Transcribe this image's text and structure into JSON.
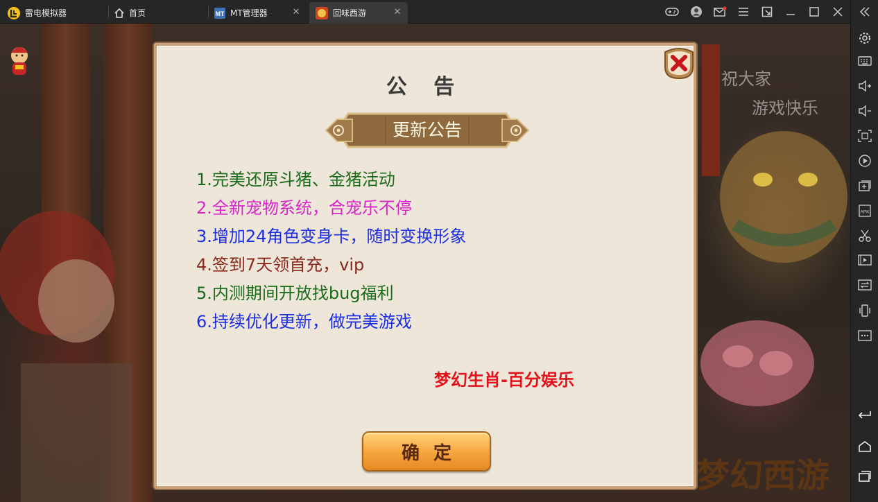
{
  "tabs": [
    {
      "label": "雷电模拟器",
      "icon": "ldplayer-logo-icon"
    },
    {
      "label": "首页",
      "icon": "home-icon"
    },
    {
      "label": "MT管理器",
      "icon": "mt-manager-icon"
    },
    {
      "label": "回味西游",
      "icon": "game-icon"
    }
  ],
  "window_controls": [
    "gamepad-icon",
    "user-icon",
    "mail-icon",
    "menu-icon",
    "popout-icon",
    "minimize-icon",
    "maximize-icon",
    "close-icon",
    "collapse-icon"
  ],
  "sidebar_icons": [
    "settings-icon",
    "keyboard-icon",
    "volume-up-icon",
    "volume-down-icon",
    "screenshot-icon",
    "record-icon",
    "add-window-icon",
    "apk-icon",
    "cut-icon",
    "video-icon",
    "sync-icon",
    "shake-icon",
    "more-icon",
    "back-icon",
    "home-icon",
    "recent-apps-icon"
  ],
  "dialog": {
    "title": "公 告",
    "banner": "更新公告",
    "notes": [
      {
        "text": "1.完美还原斗猪、金猪活动",
        "color": "#1a6b1a"
      },
      {
        "text": "2.全新宠物系统，合宠乐不停",
        "color": "#d626c8"
      },
      {
        "text": "3.增加24角色变身卡，随时变换形象",
        "color": "#1c2fe0"
      },
      {
        "text": "4.签到7天领首充，vip",
        "color": "#8a2a1e"
      },
      {
        "text": "5.内测期间开放找bug福利",
        "color": "#1a6b1a"
      },
      {
        "text": "6.持续优化更新，做完美游戏",
        "color": "#1c2fe0"
      }
    ],
    "signature": "梦幻生肖-百分娱乐",
    "confirm_label": "确定"
  },
  "background": {
    "greeting_line1": "祝大家",
    "greeting_line2": "游戏快乐",
    "logo_text": "梦幻西游"
  }
}
